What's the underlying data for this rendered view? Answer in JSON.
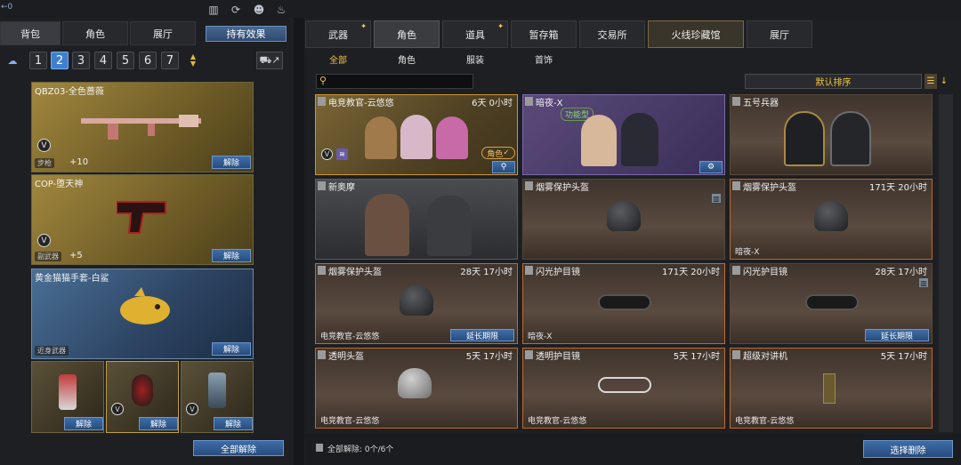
{
  "left_panel": {
    "tabs": [
      "背包",
      "角色",
      "展厅"
    ],
    "hold_effect_label": "持有效果",
    "page_numbers": [
      "1",
      "2",
      "3",
      "4",
      "5",
      "6",
      "7"
    ],
    "selected_page": "2",
    "weapons": [
      {
        "name": "QBZ03-全色蔷薇",
        "type": "步枪",
        "bonus": "+10",
        "release": "解除"
      },
      {
        "name": "COP-堕天神",
        "type": "副武器",
        "bonus": "+5",
        "release": "解除"
      },
      {
        "name": "黄金猫猫手套-白鲨",
        "type": "近身武器",
        "bonus": "",
        "release": "解除"
      }
    ],
    "grenades_release": [
      "解除",
      "解除",
      "解除"
    ],
    "release_all_label": "全部解除"
  },
  "right_panel": {
    "tabs": [
      "武器",
      "角色",
      "道具",
      "暂存箱",
      "交易所",
      "火线珍藏馆",
      "展厅"
    ],
    "active_tab": "角色",
    "subtabs": [
      "全部",
      "角色",
      "服装",
      "首饰"
    ],
    "active_subtab": "全部",
    "sort_label": "默认排序",
    "items": [
      {
        "name": "电竞教官-云悠悠",
        "time": "6天 0小时",
        "role_tag": "角色"
      },
      {
        "name": "暗夜-X",
        "time": "",
        "subtitle": "功能型"
      },
      {
        "name": "五号兵器",
        "time": ""
      },
      {
        "name": "新奥摩",
        "time": ""
      },
      {
        "name": "烟雾保护头盔",
        "time": ""
      },
      {
        "name": "烟雾保护头盔",
        "time": "171天 20小时",
        "owner": "暗夜-X"
      },
      {
        "name": "烟雾保护头盔",
        "time": "28天 17小时",
        "owner": "电竞教官-云悠悠",
        "extend": "延长期限"
      },
      {
        "name": "闪光护目镜",
        "time": "171天 20小时",
        "owner": "暗夜-X"
      },
      {
        "name": "闪光护目镜",
        "time": "28天 17小时",
        "extend": "延长期限"
      },
      {
        "name": "透明头盔",
        "time": "5天 17小时",
        "owner": "电竞教官-云悠悠"
      },
      {
        "name": "透明护目镜",
        "time": "5天 17小时",
        "owner": "电竞教官-云悠悠"
      },
      {
        "name": "超级对讲机",
        "time": "5天 17小时",
        "owner": "电竞教官-云悠悠"
      }
    ],
    "release_count_label": "全部解除: 0个/6个",
    "choose_delete_label": "选择删除"
  },
  "colors": {
    "accent_gold": "#f3c646",
    "button_blue": "#3e6da8",
    "orange_border": "#c06a2c"
  }
}
